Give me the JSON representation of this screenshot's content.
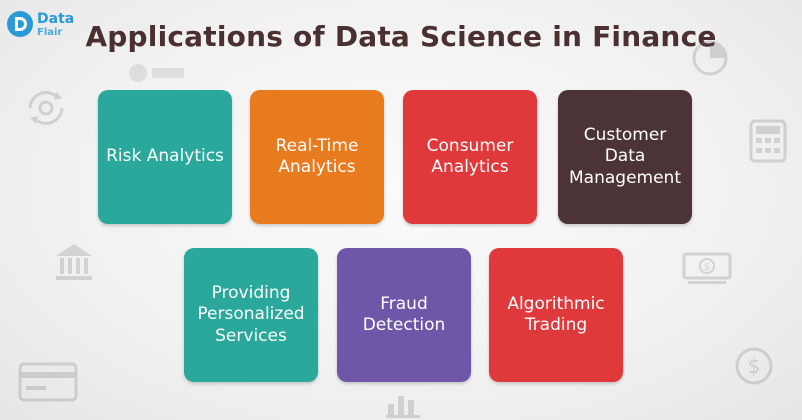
{
  "brand": {
    "line1": "Data",
    "line2": "Flair",
    "color": "#2a9ad6"
  },
  "title": "Applications of Data Science in Finance",
  "cards": [
    {
      "label": "Risk Analytics",
      "color": "#2aa89b"
    },
    {
      "label": "Real-Time\nAnalytics",
      "color": "#e97b1f"
    },
    {
      "label": "Consumer\nAnalytics",
      "color": "#e0393c"
    },
    {
      "label": "Customer Data\nManagement",
      "color": "#4c3436"
    },
    {
      "label": "Providing\nPersonalized\nServices",
      "color": "#2aa89b"
    },
    {
      "label": "Fraud\nDetection",
      "color": "#6e57a8"
    },
    {
      "label": "Algorithmic\nTrading",
      "color": "#e0393c"
    }
  ],
  "decorations": [
    "refresh-gears-icon",
    "bank-icon",
    "credit-card-icon",
    "pie-chart-icon",
    "calculator-icon",
    "cash-icon",
    "dollar-coin-icon",
    "bar-chart-icon",
    "watermark-logo-icon"
  ]
}
